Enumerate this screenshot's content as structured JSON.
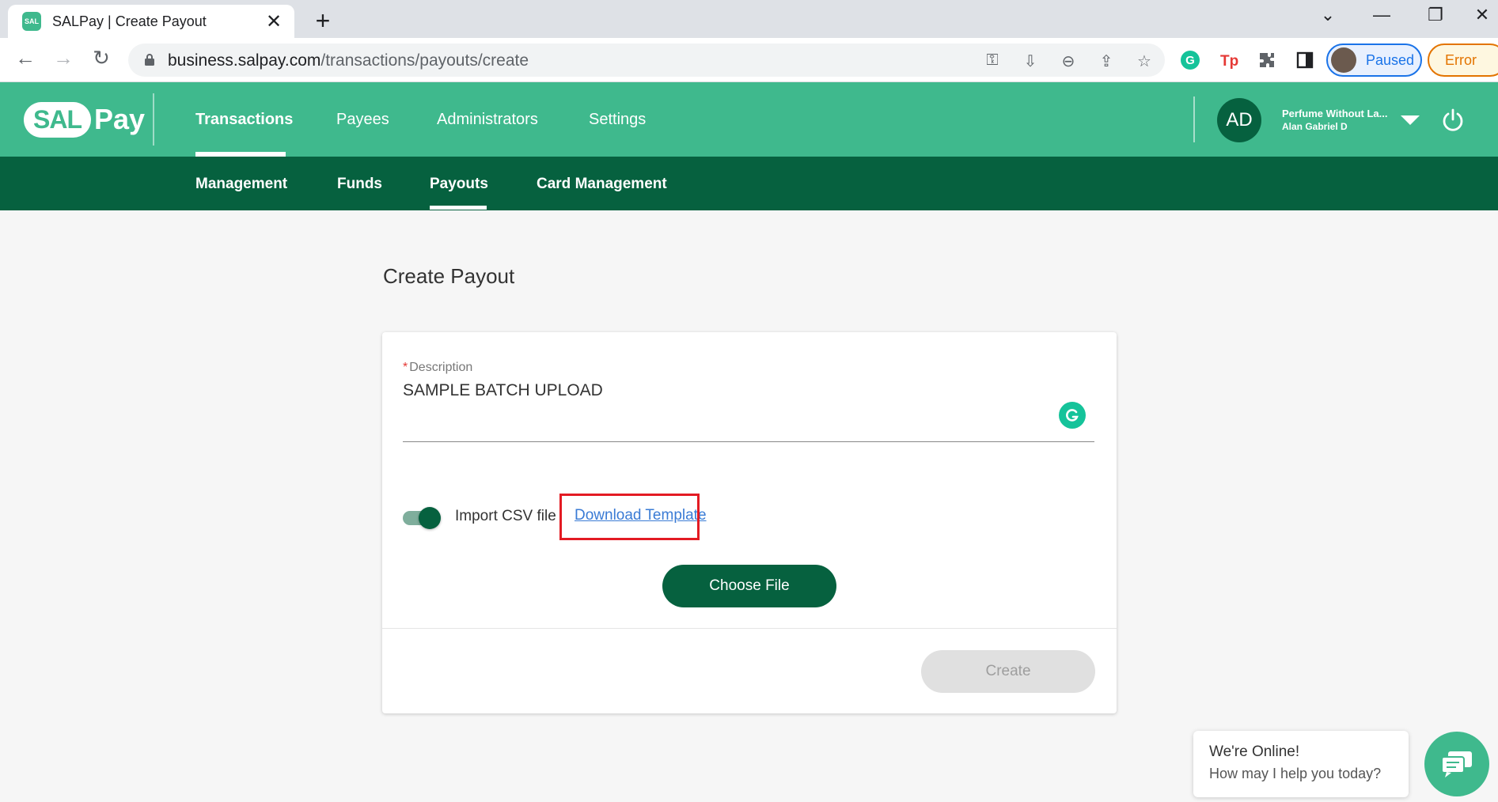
{
  "browser": {
    "tab_title": "SALPay | Create Payout",
    "tab_close": "✕",
    "new_tab": "+",
    "url_host": "business.salpay.com",
    "url_path": "/transactions/payouts/create",
    "profile_label": "Paused",
    "error_label": "Error"
  },
  "header": {
    "logo_sal": "SAL",
    "logo_pay": "Pay",
    "nav": [
      "Transactions",
      "Payees",
      "Administrators",
      "Settings"
    ],
    "avatar_initials": "AD",
    "account_name": "Perfume Without La...",
    "account_user": "Alan Gabriel D"
  },
  "sub_nav": [
    "Management",
    "Funds",
    "Payouts",
    "Card Management"
  ],
  "page": {
    "title": "Create Payout",
    "description_label": "Description",
    "description_value": "SAMPLE BATCH UPLOAD",
    "import_csv_label": "Import CSV file",
    "download_template": "Download Template",
    "choose_file": "Choose File",
    "create": "Create"
  },
  "chat": {
    "title": "We're Online!",
    "subtitle": "How may I help you today?"
  },
  "colors": {
    "primary": "#3fb98d",
    "dark": "#06613f",
    "highlight": "#e31b23",
    "link": "#3a7bd5"
  },
  "icons": [
    "back-icon",
    "forward-icon",
    "reload-icon",
    "lock-icon",
    "key-icon",
    "install-icon",
    "zoom-icon",
    "share-icon",
    "star-icon",
    "grammarly-icon",
    "tp-icon",
    "puzzle-icon",
    "sidepanel-icon",
    "power-icon",
    "chat-icon"
  ]
}
